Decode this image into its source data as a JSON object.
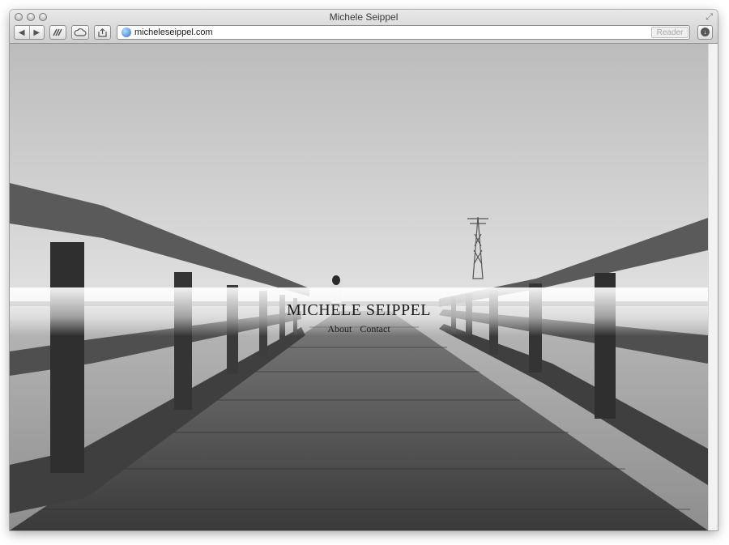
{
  "window": {
    "title": "Michele Seippel"
  },
  "toolbar": {
    "back_glyph": "◀",
    "forward_glyph": "▶",
    "url": "micheleseippel.com",
    "reader_label": "Reader"
  },
  "site": {
    "title": "MICHELE SEIPPEL",
    "nav": [
      "About",
      "Contact"
    ]
  },
  "icons": [
    "close-icon",
    "minimize-icon",
    "zoom-icon",
    "fullscreen-icon",
    "back-icon",
    "forward-icon",
    "history-icon",
    "icloud-tabs-icon",
    "share-icon",
    "globe-icon",
    "downloads-icon"
  ],
  "colors": {
    "toolbar_top": "#e9e9e9",
    "toolbar_bottom": "#cdcdcd",
    "globe": "#2c74c8"
  }
}
